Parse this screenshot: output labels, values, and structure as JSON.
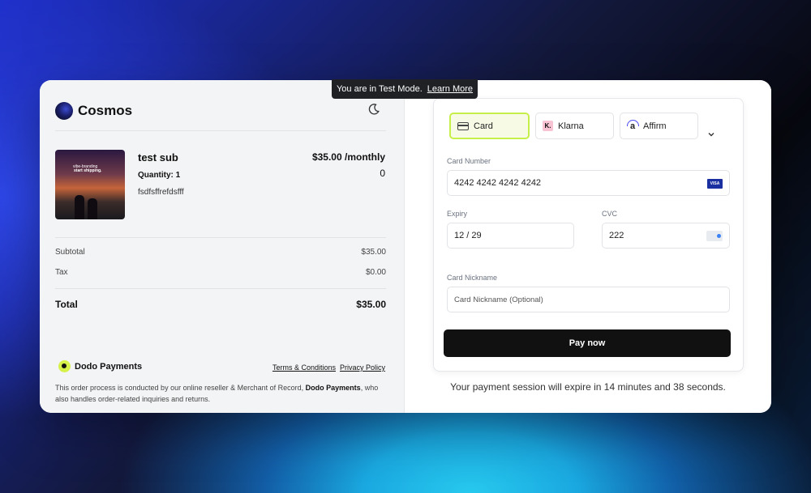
{
  "test_mode": {
    "text": "You are in Test Mode.",
    "link": "Learn More"
  },
  "merchant": {
    "name": "Cosmos"
  },
  "product": {
    "name": "test sub",
    "quantity": "Quantity: 1",
    "description": "fsdfsffrefdsfff",
    "price": "$35.00 /monthly",
    "price_extra": "0",
    "image_line1": "vibe-branding",
    "image_line2": "start shipping."
  },
  "summary": {
    "subtotal_label": "Subtotal",
    "subtotal_value": "$35.00",
    "tax_label": "Tax",
    "tax_value": "$0.00",
    "total_label": "Total",
    "total_value": "$35.00"
  },
  "footer": {
    "brand": "Dodo Payments",
    "terms": "Terms & Conditions",
    "privacy": "Privacy Policy",
    "legal_prefix": "This order process is conducted by our online reseller & Merchant of Record,",
    "legal_bold": "Dodo Payments",
    "legal_suffix": ", who also handles order-related inquiries and returns."
  },
  "payment": {
    "tabs": [
      {
        "label": "Card",
        "icon": "credit-card-icon",
        "active": true
      },
      {
        "label": "Klarna",
        "icon": "klarna-icon",
        "active": false
      },
      {
        "label": "Affirm",
        "icon": "affirm-icon",
        "active": false
      }
    ],
    "klarna_letter": "K.",
    "affirm_letter": "a",
    "card_number_label": "Card Number",
    "card_number_value": "4242 4242 4242 4242",
    "card_brand": "VISA",
    "expiry_label": "Expiry",
    "expiry_value": "12 / 29",
    "cvc_label": "CVC",
    "cvc_value": "222",
    "nickname_label": "Card Nickname",
    "nickname_placeholder": "Card Nickname (Optional)",
    "pay_button": "Pay now",
    "expiry_notice": "Your payment session will expire in 14 minutes and 38 seconds."
  },
  "colors": {
    "accent": "#c7ef4a",
    "pay_button": "#111111",
    "card_brand": "#1a2fa0"
  }
}
